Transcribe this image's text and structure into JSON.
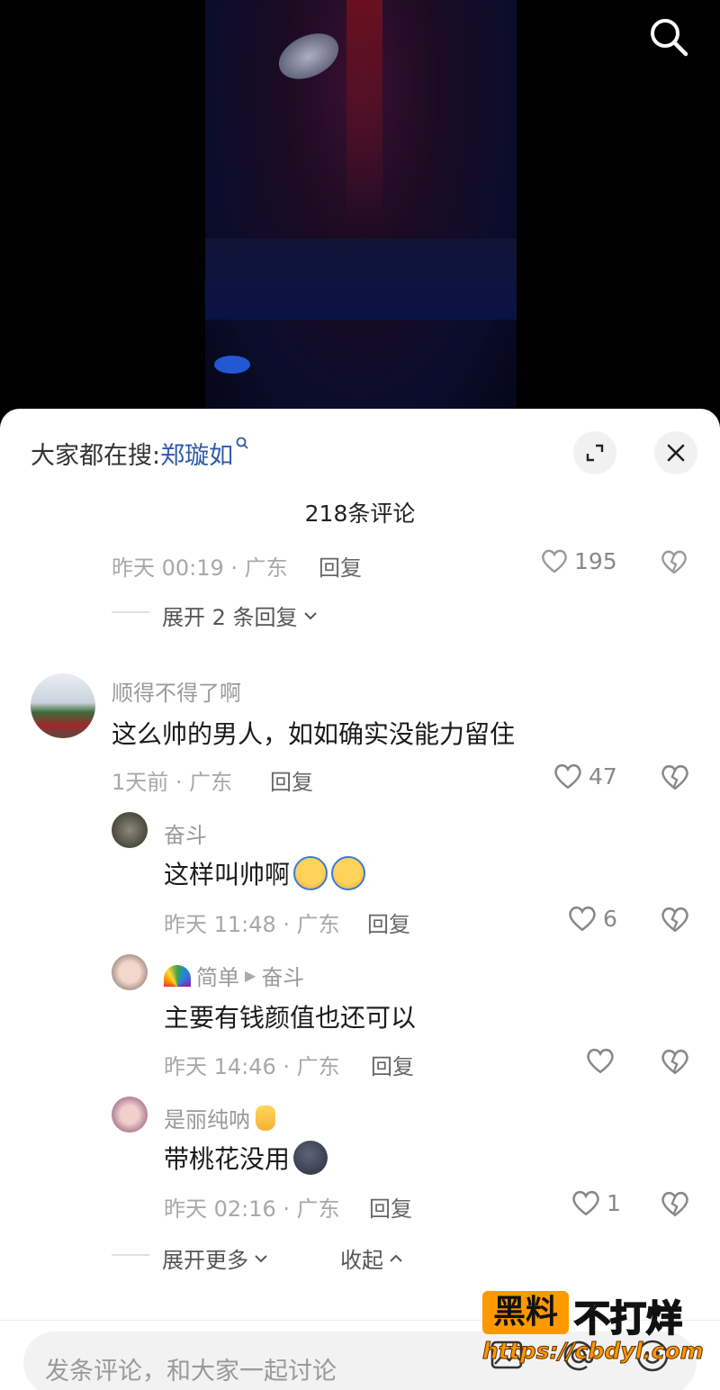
{
  "hot_search": {
    "prefix": "大家都在搜:",
    "keyword": "郑璇如"
  },
  "comment_count": "218条评论",
  "prev_comment": {
    "meta": "昨天 00:19 · 广东",
    "reply": "回复",
    "likes": "195"
  },
  "expand_prev": "展开 2 条回复",
  "main_comment": {
    "user": "顺得不得了啊",
    "text": "这么帅的男人，如如确实没能力留住",
    "meta": "1天前 · 广东",
    "reply": "回复",
    "likes": "47"
  },
  "replies": [
    {
      "user": "奋斗",
      "text": "这样叫帅啊",
      "emoji": [
        "crying-laughing-emoji",
        "crying-laughing-emoji"
      ],
      "meta": "昨天 11:48 · 广东",
      "reply": "回复",
      "likes": "6"
    },
    {
      "user": "简单",
      "prefix_emoji": "rainbow-emoji",
      "reply_to": "奋斗",
      "text": "主要有钱颜值也还可以",
      "meta": "昨天 14:46 · 广东",
      "reply": "回复",
      "likes": ""
    },
    {
      "user": "是丽纯呐",
      "suffix_emoji": "victory-hand-emoji",
      "text": "带桃花没用",
      "emoji": [
        "dark-face-emoji"
      ],
      "meta": "昨天 02:16 · 广东",
      "reply": "回复",
      "likes": "1"
    }
  ],
  "expand_more": "展开更多",
  "collapse": "收起",
  "input_placeholder": "发条评论，和大家一起讨论",
  "watermark": {
    "brand": "黑料",
    "slogan": "不打烊",
    "url": "https://cbdyl.com"
  },
  "colors": {
    "keyword": "#2f59a8",
    "sheet": "#ffffff",
    "watermark": "#ff9900"
  }
}
